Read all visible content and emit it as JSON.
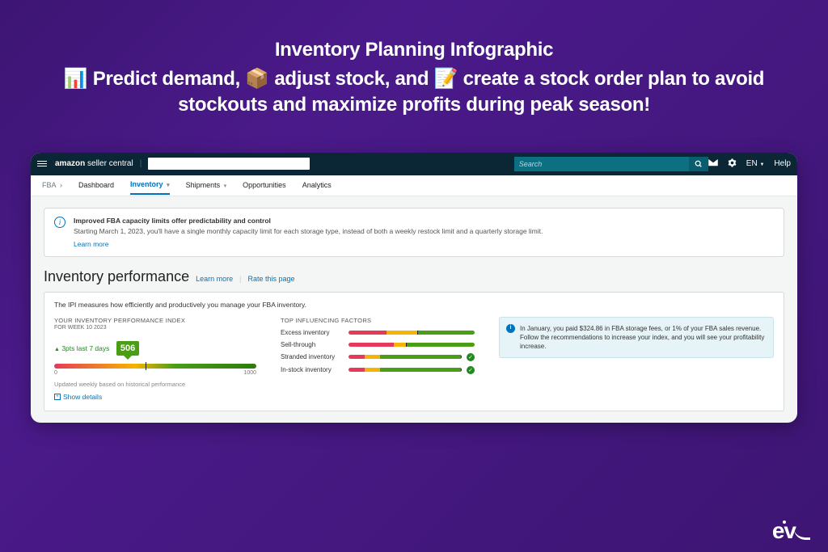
{
  "headline": {
    "title": "Inventory Planning Infographic",
    "line": "📊 Predict demand, 📦 adjust stock, and 📝 create a stock order plan to avoid stockouts and maximize profits during peak season!"
  },
  "topbar": {
    "brand_primary": "amazon",
    "brand_secondary": "seller central",
    "search_placeholder": "Search",
    "lang_label": "EN",
    "help_label": "Help"
  },
  "tabs": {
    "crumb": "FBA",
    "items": [
      {
        "label": "Dashboard"
      },
      {
        "label": "Inventory",
        "active": true,
        "chevron": true
      },
      {
        "label": "Shipments",
        "chevron": true
      },
      {
        "label": "Opportunities"
      },
      {
        "label": "Analytics"
      }
    ]
  },
  "banner": {
    "title": "Improved FBA capacity limits offer predictability and control",
    "desc": "Starting March 1, 2023, you'll have a single monthly capacity limit for each storage type, instead of both a weekly restock limit and a quarterly storage limit.",
    "learn_more": "Learn more"
  },
  "page": {
    "title": "Inventory performance",
    "learn_more": "Learn more",
    "rate": "Rate this page"
  },
  "ipi": {
    "intro": "The IPI measures how efficiently and productively you manage your FBA inventory.",
    "header": "YOUR INVENTORY PERFORMANCE INDEX",
    "week": "FOR WEEK 10 2023",
    "delta": "3pts last 7 days",
    "score": "506",
    "scale_min": "0",
    "scale_max": "1000",
    "note": "Updated weekly based on historical performance",
    "show_details": "Show details"
  },
  "factors": {
    "header": "TOP INFLUENCING FACTORS",
    "rows": [
      {
        "name": "Excess inventory"
      },
      {
        "name": "Sell-through"
      },
      {
        "name": "Stranded inventory",
        "check": true
      },
      {
        "name": "In-stock inventory",
        "check": true
      }
    ]
  },
  "hint": {
    "text": "In January, you paid $324.86 in FBA storage fees, or 1% of your FBA sales revenue. Follow the recommendations to increase your index, and you will see your profitability increase."
  },
  "footer_logo": "eva"
}
